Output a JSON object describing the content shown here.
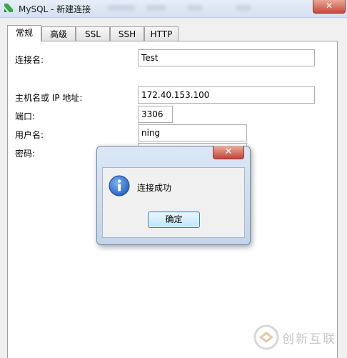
{
  "window": {
    "title": "MySQL - 新建连接",
    "close_glyph": "✕"
  },
  "tabs": [
    {
      "label": "常规",
      "active": true
    },
    {
      "label": "高级",
      "active": false
    },
    {
      "label": "SSL",
      "active": false
    },
    {
      "label": "SSH",
      "active": false
    },
    {
      "label": "HTTP",
      "active": false
    }
  ],
  "form": {
    "connection_name_label": "连接名:",
    "connection_name_value": "Test",
    "host_label": "主机名或 IP 地址:",
    "host_value": "172.40.153.100",
    "port_label": "端口:",
    "port_value": "3306",
    "user_label": "用户名:",
    "user_value": "ning",
    "password_label": "密码:"
  },
  "dialog": {
    "message": "连接成功",
    "ok_label": "确定",
    "close_glyph": "✕"
  },
  "watermark": {
    "text": "创新互联"
  },
  "colors": {
    "app_icon": "#3aa845",
    "info_icon": "#1f5fbf"
  }
}
